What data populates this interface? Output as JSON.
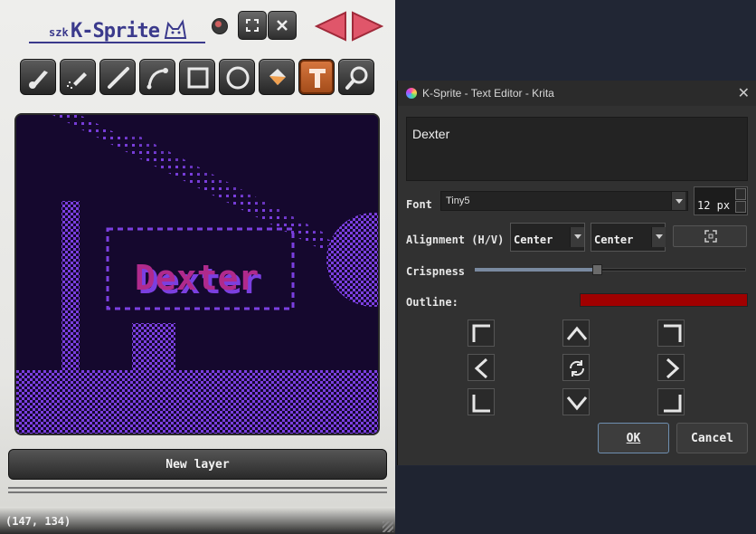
{
  "ksprite": {
    "logo_prefix": "szk",
    "logo_name": "K-Sprite",
    "toolbar_top": [
      {
        "name": "record-dot-button",
        "icon": "record-dot-icon"
      },
      {
        "name": "fit-frame-button",
        "icon": "fit-frame-icon"
      },
      {
        "name": "close-button",
        "icon": "close-icon"
      },
      {
        "name": "prev-arrow-button",
        "icon": "arrow-left-icon"
      },
      {
        "name": "next-arrow-button",
        "icon": "arrow-right-icon"
      }
    ],
    "tools": [
      "brush",
      "spray",
      "line",
      "curve",
      "rectangle",
      "ellipse",
      "fill",
      "text",
      "zoom"
    ],
    "active_tool": "text",
    "canvas_text": "Dexter",
    "new_layer_label": "New layer",
    "coords": "(147, 134)"
  },
  "dialog": {
    "title": "K-Sprite - Text Editor - Krita",
    "text_value": "Dexter",
    "font_label": "Font",
    "font_value": "Tiny5",
    "size_value": "12 px",
    "alignment_label": "Alignment (H/V)",
    "align_h": "Center",
    "align_v": "Center",
    "crispness_label": "Crispness",
    "crispness_value": 0.45,
    "outline_label": "Outline:",
    "outline_color": "#a00000",
    "ok_label": "OK",
    "cancel_label": "Cancel"
  },
  "colors": {
    "canvas_bg": "#15082e",
    "pixel_purple": "#7b3fe0",
    "text_magenta": "#b02a8c",
    "accent_orange": "#d97840",
    "arrow_red": "#e0566a"
  }
}
